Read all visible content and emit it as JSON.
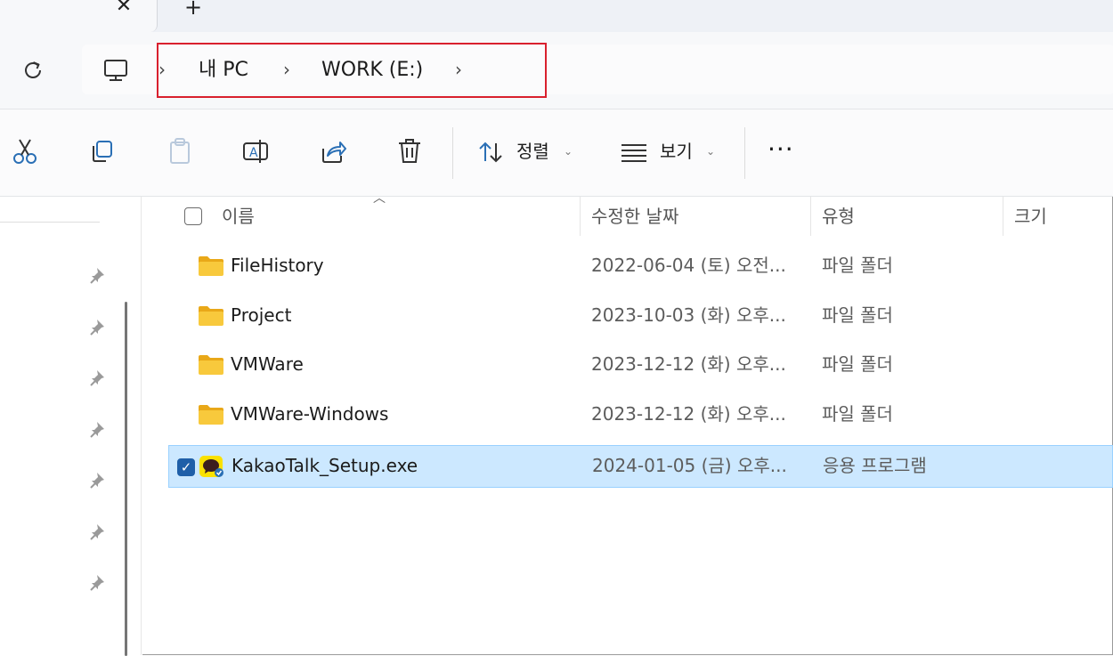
{
  "tabs": {
    "close_glyph": "✕",
    "new_glyph": "+"
  },
  "breadcrumb": {
    "items": [
      "내 PC",
      "WORK (E:)"
    ],
    "separator": "›",
    "highlight_color": "#d9202e"
  },
  "toolbar": {
    "sort_label": "정렬",
    "view_label": "보기",
    "more_label": "···",
    "caret": "⌄",
    "icons": [
      "cut-icon",
      "copy-icon",
      "paste-icon",
      "rename-icon",
      "share-icon",
      "delete-icon",
      "sort-icon",
      "view-icon"
    ]
  },
  "columns": {
    "name": "이름",
    "modified": "수정한 날짜",
    "type": "유형",
    "size": "크기"
  },
  "files": [
    {
      "name": "FileHistory",
      "modified": "2022-06-04 (토) 오전...",
      "type": "파일 폴더",
      "icon": "folder-icon",
      "selected": false
    },
    {
      "name": "Project",
      "modified": "2023-10-03 (화) 오후...",
      "type": "파일 폴더",
      "icon": "folder-icon",
      "selected": false
    },
    {
      "name": "VMWare",
      "modified": "2023-12-12 (화) 오후...",
      "type": "파일 폴더",
      "icon": "folder-icon",
      "selected": false
    },
    {
      "name": "VMWare-Windows",
      "modified": "2023-12-12 (화) 오후...",
      "type": "파일 폴더",
      "icon": "folder-icon",
      "selected": false
    },
    {
      "name": "KakaoTalk_Setup.exe",
      "modified": "2024-01-05 (금) 오후...",
      "type": "응용 프로그램",
      "icon": "kakaotalk-app-icon",
      "selected": true
    }
  ],
  "colors": {
    "accent": "#1f5fa8",
    "selection": "#cce8ff",
    "folder": "#f5c542"
  }
}
